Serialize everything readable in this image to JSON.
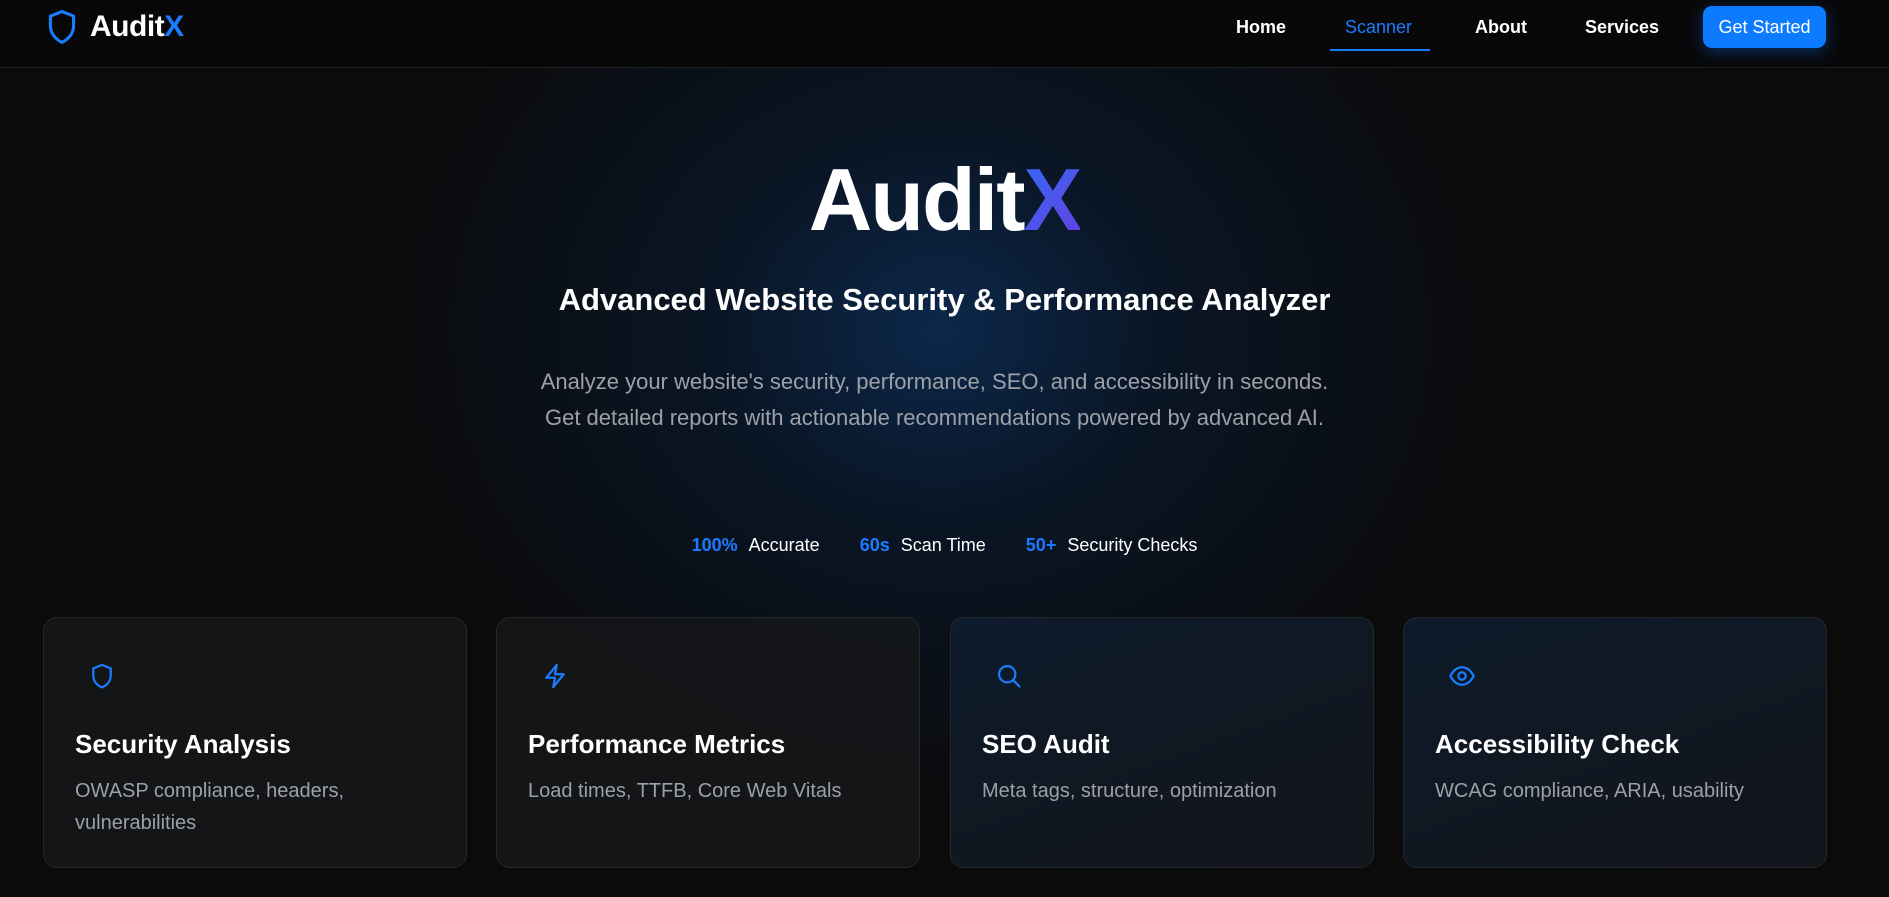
{
  "nav": {
    "brand": {
      "name": "Audit",
      "accent": "X",
      "icon": "shield-icon"
    },
    "links": [
      {
        "label": "Home",
        "active": false
      },
      {
        "label": "Scanner",
        "active": true
      },
      {
        "label": "About",
        "active": false
      },
      {
        "label": "Services",
        "active": false
      }
    ],
    "cta_label": "Get Started"
  },
  "hero": {
    "title_main": "Audit",
    "title_accent": "X",
    "subtitle": "Advanced Website Security & Performance Analyzer",
    "description": "Analyze your website's security, performance, SEO, and accessibility in seconds. Get detailed reports with actionable recommendations powered by advanced AI.",
    "stats": [
      {
        "value": "100%",
        "label": "Accurate"
      },
      {
        "value": "60s",
        "label": "Scan Time"
      },
      {
        "value": "50+",
        "label": "Security Checks"
      }
    ]
  },
  "features": [
    {
      "icon": "shield-icon",
      "title": "Security Analysis",
      "description": "OWASP compliance, headers, vulnerabilities"
    },
    {
      "icon": "lightning-icon",
      "title": "Performance Metrics",
      "description": "Load times, TTFB, Core Web Vitals"
    },
    {
      "icon": "search-icon",
      "title": "SEO Audit",
      "description": "Meta tags, structure, optimization"
    },
    {
      "icon": "eye-icon",
      "title": "Accessibility Check",
      "description": "WCAG compliance, ARIA, usability"
    }
  ],
  "colors": {
    "accent": "#1a7cff",
    "button": "#0d7bff",
    "background": "#0b0b0c",
    "muted_text": "#9ca0a8",
    "title_gradient": [
      "#2f6cf5",
      "#6a3ee0"
    ]
  }
}
